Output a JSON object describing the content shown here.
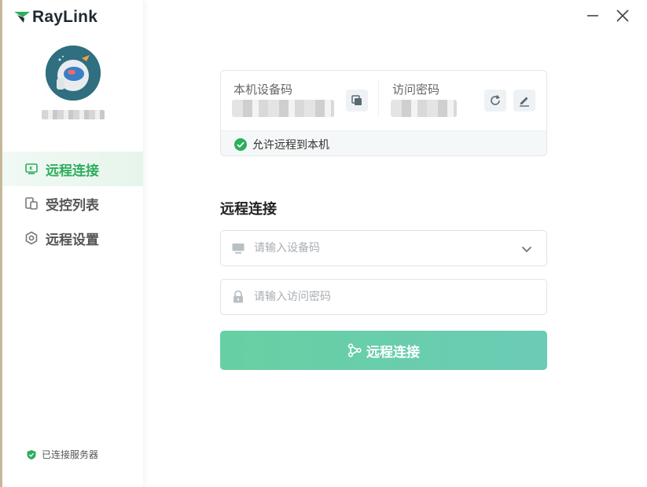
{
  "app": {
    "logo_text": "RayLink",
    "accent_color": "#2dae5b"
  },
  "sidebar": {
    "items": [
      {
        "label": "远程连接",
        "icon": "monitor-icon",
        "active": true
      },
      {
        "label": "受控列表",
        "icon": "devices-icon",
        "active": false
      },
      {
        "label": "远程设置",
        "icon": "settings-hex-icon",
        "active": false
      }
    ],
    "server_status": "已连接服务器"
  },
  "device_card": {
    "device_code_label": "本机设备码",
    "access_password_label": "访问密码",
    "allow_remote_label": "允许远程到本机"
  },
  "connect": {
    "title": "远程连接",
    "device_placeholder": "请输入设备码",
    "password_placeholder": "请输入访问密码",
    "button_label": "远程连接"
  }
}
